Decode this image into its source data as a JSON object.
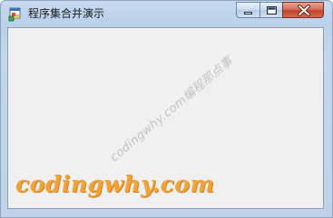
{
  "window": {
    "title": "程序集合并演示",
    "icon": "app-window-icon",
    "buttons": {
      "minimize": "minimize-icon",
      "maximize": "maximize-icon",
      "close": "close-icon"
    }
  },
  "watermark": {
    "diagonal_text": "codingwhy.com编程那点事",
    "brand_text": "codingwhy.com"
  },
  "colors": {
    "client_background": "#f0f0f0",
    "brand_orange": "#f0a437",
    "close_button_red": "#c2412a"
  }
}
